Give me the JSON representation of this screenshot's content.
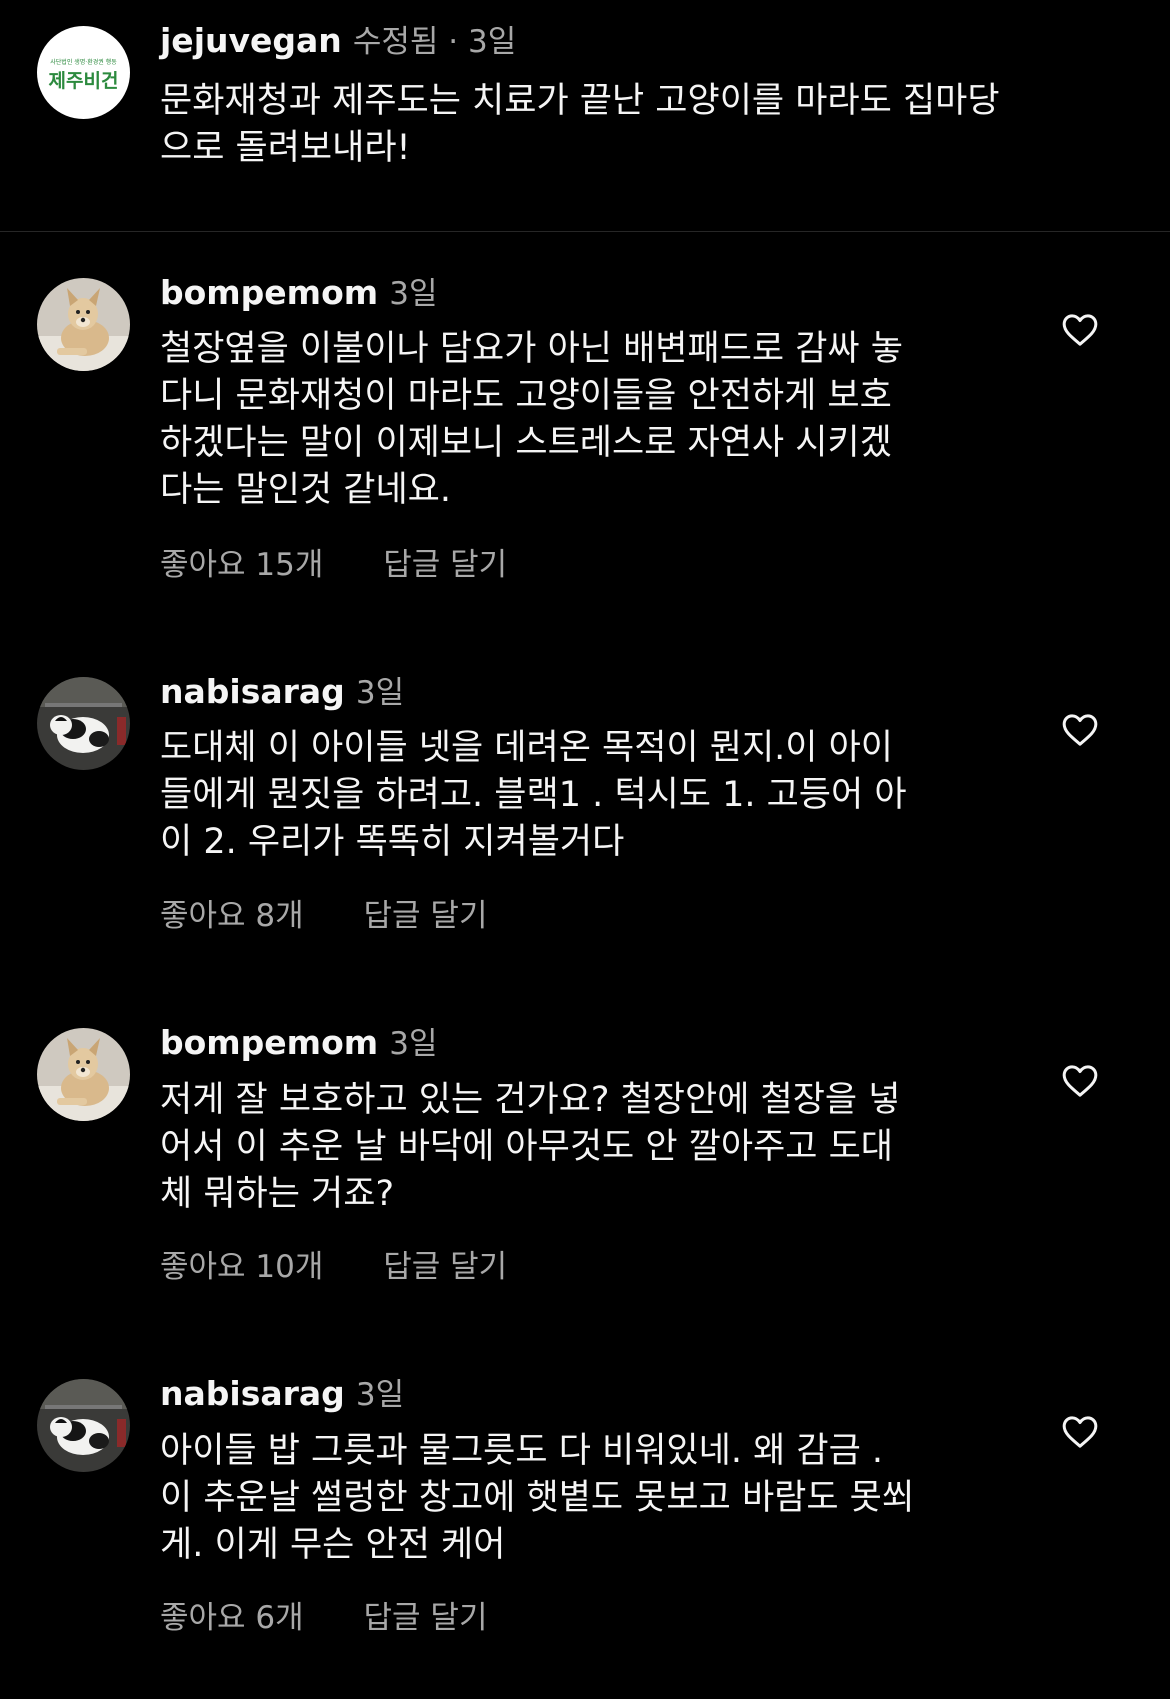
{
  "post": {
    "username": "jejuvegan",
    "meta": "수정됨 · 3일",
    "text": "문화재청과 제주도는 치료가 끝난 고양이를 마라도 집마당\n으로 돌려보내라!",
    "avatar_logo_small": "사단법인 생명‧환경권 행동",
    "avatar_logo_main": "제주비건"
  },
  "comments": [
    {
      "username": "bompemom",
      "time": "3일",
      "text": "철장옆을 이불이나 담요가 아닌 배변패드로 감싸 놓\n다니 문화재청이 마라도 고양이들을 안전하게 보호\n하겠다는 말이 이제보니 스트레스로 자연사 시키겠\n다는 말인것 같네요.",
      "likes": "좋아요 15개",
      "reply": "답글 달기",
      "avatar_icon": "dog-photo"
    },
    {
      "username": "nabisarag",
      "time": "3일",
      "text": "도대체 이 아이들 넷을 데려온 목적이 뭔지.이 아이\n들에게 뭔짓을 하려고. 블랙1 . 턱시도 1. 고등어 아\n이 2. 우리가 똑똑히 지켜볼거다",
      "likes": "좋아요 8개",
      "reply": "답글 달기",
      "avatar_icon": "cat-photo"
    },
    {
      "username": "bompemom",
      "time": "3일",
      "text": "저게 잘 보호하고 있는 건가요? 철장안에 철장을 넣\n어서 이 추운 날 바닥에 아무것도 안 깔아주고 도대\n체 뭐하는 거죠?",
      "likes": "좋아요 10개",
      "reply": "답글 달기",
      "avatar_icon": "dog-photo"
    },
    {
      "username": "nabisarag",
      "time": "3일",
      "text": "아이들 밥 그릇과 물그릇도 다 비워있네. 왜 감금 .\n이 추운날 썰렁한 창고에 햇볕도 못보고 바람도 못쐬\n게. 이게 무슨 안전 케어",
      "likes": "좋아요 6개",
      "reply": "답글 달기",
      "avatar_icon": "cat-photo"
    }
  ],
  "colors": {
    "background": "#000000",
    "text_primary": "#f5f5f5",
    "text_secondary": "#a8a8a8",
    "divider": "#262626",
    "logo_green": "#2c8a3e"
  }
}
